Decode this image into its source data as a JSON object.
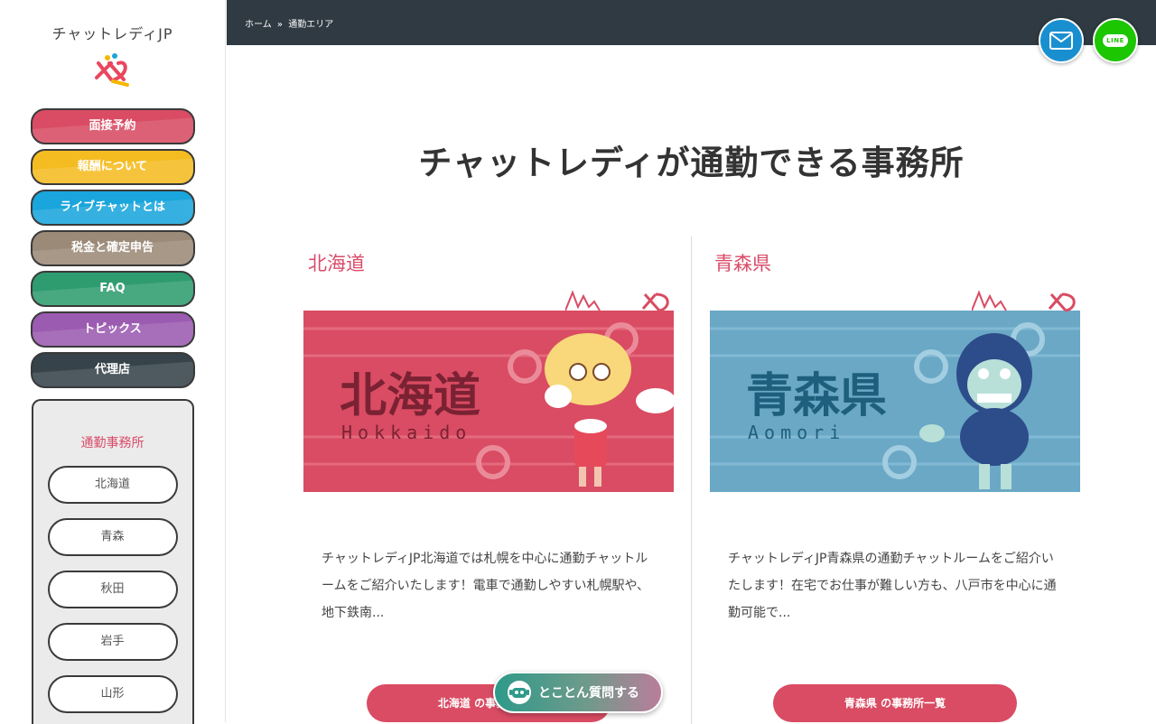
{
  "sidebar": {
    "brand": "チャットレディJP",
    "menu": [
      {
        "label": "面接予約",
        "color": "#d94c63"
      },
      {
        "label": "報酬について",
        "color": "#f5bc22"
      },
      {
        "label": "ライブチャットとは",
        "color": "#1aa5dc"
      },
      {
        "label": "税金と確定申告",
        "color": "#9b8a78"
      },
      {
        "label": "FAQ",
        "color": "#2f9c6f"
      },
      {
        "label": "トピックス",
        "color": "#9b5bb0"
      },
      {
        "label": "代理店",
        "color": "#36434b"
      }
    ],
    "office_title": "通勤事務所",
    "prefectures": [
      "北海道",
      "青森",
      "秋田",
      "岩手",
      "山形"
    ]
  },
  "header": {
    "breadcrumb": [
      "ホーム",
      "通勤エリア"
    ],
    "breadcrumb_sep": "»"
  },
  "main": {
    "title": "チャットレディが通勤できる事務所",
    "cards": [
      {
        "name": "北海道",
        "banner_title": "北海道",
        "banner_sub": "Hokkaido",
        "banner_color": "#d94c63",
        "description": "チャットレディJP北海道では札幌を中心に通勤チャットルームをご紹介いたします！電車で通勤しやすい札幌駅や、地下鉄南...",
        "link_label": "北海道 の事務所一覧"
      },
      {
        "name": "青森県",
        "banner_title": "青森県",
        "banner_sub": "Aomori",
        "banner_color": "#6aa8c6",
        "description": "チャットレディJP青森県の通勤チャットルームをご紹介いたします！在宅でお仕事が難しい方も、八戸市を中心に通勤可能で...",
        "link_label": "青森県 の事務所一覧"
      }
    ]
  },
  "chat_widget": {
    "label": "とことん質問する"
  }
}
